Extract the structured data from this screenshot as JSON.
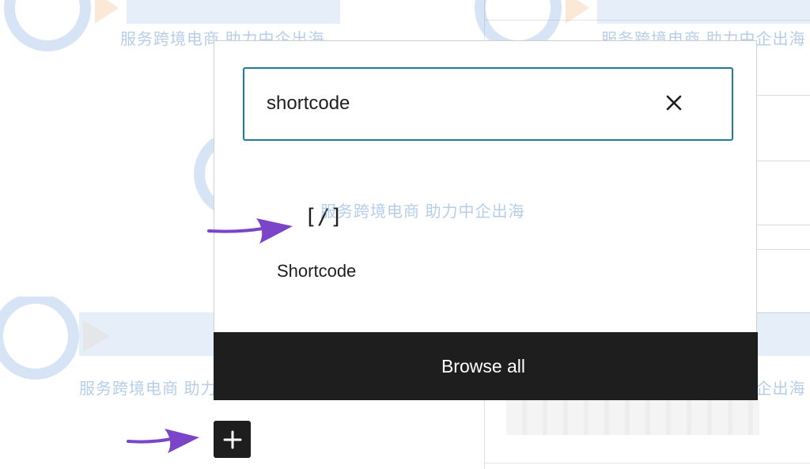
{
  "search": {
    "value": "shortcode",
    "placeholder": "Search"
  },
  "results": [
    {
      "icon_glyph": "[/]",
      "icon_name": "shortcode-icon",
      "label": "Shortcode"
    }
  ],
  "footer": {
    "browse_all_label": "Browse all"
  },
  "add_block": {
    "icon_name": "plus-icon"
  },
  "annotations": {
    "arrow_color": "#7b45c9"
  },
  "watermark": {
    "tagline": "服务跨境电商 助力中企出海"
  },
  "colors": {
    "search_border": "#1f7a9c",
    "dark": "#1e1e1e"
  }
}
